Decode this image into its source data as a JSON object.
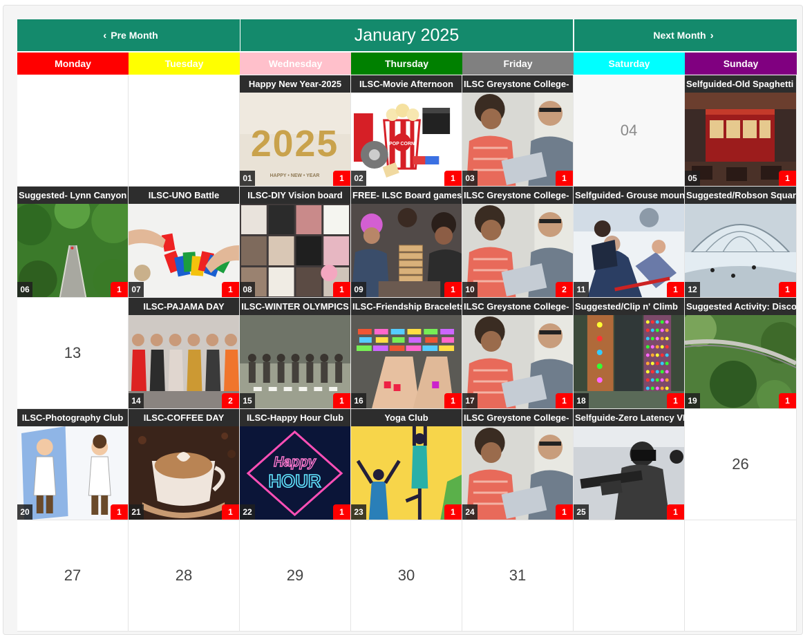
{
  "nav": {
    "prev_label": "Pre Month",
    "next_label": "Next Month",
    "month_title": "January 2025",
    "bar_color": "#148a6c"
  },
  "weekdays": [
    {
      "label": "Monday",
      "bg": "#ff0000",
      "fg": "#ffffff"
    },
    {
      "label": "Tuesday",
      "bg": "#ffff00",
      "fg": "#ffffff"
    },
    {
      "label": "Wednesday",
      "bg": "#ffc0cb",
      "fg": "#ffffff"
    },
    {
      "label": "Thursday",
      "bg": "#008000",
      "fg": "#ffffff"
    },
    {
      "label": "Friday",
      "bg": "#808080",
      "fg": "#ffffff"
    },
    {
      "label": "Saturday",
      "bg": "#00ffff",
      "fg": "#ffffff"
    },
    {
      "label": "Sunday",
      "bg": "#800080",
      "fg": "#ffffff"
    }
  ],
  "days": [
    {
      "day": "",
      "type": "blank"
    },
    {
      "day": "",
      "type": "blank"
    },
    {
      "day": "01",
      "type": "event",
      "title": "Happy New Year-2025",
      "count": "1",
      "image": "new-year-2025"
    },
    {
      "day": "02",
      "type": "event",
      "title": "ILSC-Movie Afternoon",
      "count": "1",
      "image": "movie-popcorn"
    },
    {
      "day": "03",
      "type": "event",
      "title": "ILSC Greystone College-",
      "count": "1",
      "image": "people-laptop"
    },
    {
      "day": "04",
      "type": "number"
    },
    {
      "day": "05",
      "type": "event",
      "title": "Selfguided-Old Spaghetti",
      "count": "1",
      "image": "tram-restaurant"
    },
    {
      "day": "06",
      "type": "event",
      "title": "Suggested- Lynn Canyon",
      "count": "1",
      "image": "suspension-bridge"
    },
    {
      "day": "07",
      "type": "event",
      "title": "ILSC-UNO Battle",
      "count": "1",
      "image": "uno-cards"
    },
    {
      "day": "08",
      "type": "event",
      "title": "ILSC-DIY Vision board",
      "count": "1",
      "image": "vision-board"
    },
    {
      "day": "09",
      "type": "event",
      "title": "FREE- ILSC Board games",
      "count": "1",
      "image": "jenga-friends"
    },
    {
      "day": "10",
      "type": "event",
      "title": "ILSC Greystone College-",
      "count": "2",
      "image": "people-laptop"
    },
    {
      "day": "11",
      "type": "event",
      "title": "Selfguided- Grouse mountain",
      "count": "1",
      "image": "snow-sledding"
    },
    {
      "day": "12",
      "type": "event",
      "title": "Suggested/Robson Square",
      "count": "1",
      "image": "ice-rink-dome"
    },
    {
      "day": "13",
      "type": "number"
    },
    {
      "day": "14",
      "type": "event",
      "title": "ILSC-PAJAMA DAY",
      "count": "2",
      "image": "pajama-group"
    },
    {
      "day": "15",
      "type": "event",
      "title": "ILSC-WINTER OLYMPICS",
      "count": "1",
      "image": "gym-games"
    },
    {
      "day": "16",
      "type": "event",
      "title": "ILSC-Friendship Bracelets",
      "count": "1",
      "image": "bracelets"
    },
    {
      "day": "17",
      "type": "event",
      "title": "ILSC Greystone College-",
      "count": "1",
      "image": "people-laptop"
    },
    {
      "day": "18",
      "type": "event",
      "title": "Suggested/Clip n' Climb",
      "count": "1",
      "image": "climbing-wall"
    },
    {
      "day": "19",
      "type": "event",
      "title": "Suggested Activity: Discover",
      "count": "1",
      "image": "treetop-walk"
    },
    {
      "day": "20",
      "type": "event",
      "title": "ILSC-Photography Club",
      "count": "1",
      "image": "cartoon-mirror"
    },
    {
      "day": "21",
      "type": "event",
      "title": "ILSC-COFFEE DAY",
      "count": "1",
      "image": "coffee-cup"
    },
    {
      "day": "22",
      "type": "event",
      "title": "ILSC-Happy Hour Club",
      "count": "1",
      "image": "neon-happy-hour"
    },
    {
      "day": "23",
      "type": "event",
      "title": "Yoga Club",
      "count": "1",
      "image": "yoga-figures"
    },
    {
      "day": "24",
      "type": "event",
      "title": "ILSC Greystone College-",
      "count": "1",
      "image": "people-laptop"
    },
    {
      "day": "25",
      "type": "event",
      "title": "Selfguide-Zero Latency VR",
      "count": "1",
      "image": "vr-gamer"
    },
    {
      "day": "26",
      "type": "number"
    },
    {
      "day": "27",
      "type": "number"
    },
    {
      "day": "28",
      "type": "number"
    },
    {
      "day": "29",
      "type": "number"
    },
    {
      "day": "30",
      "type": "number"
    },
    {
      "day": "31",
      "type": "number"
    },
    {
      "day": "",
      "type": "blank"
    },
    {
      "day": "",
      "type": "blank"
    }
  ],
  "neon_text": [
    "Happy",
    "HOUR"
  ],
  "image_text": {
    "year": "2025",
    "year_caption": "HAPPY • NEW • YEAR",
    "popcorn": "POP CORN"
  }
}
